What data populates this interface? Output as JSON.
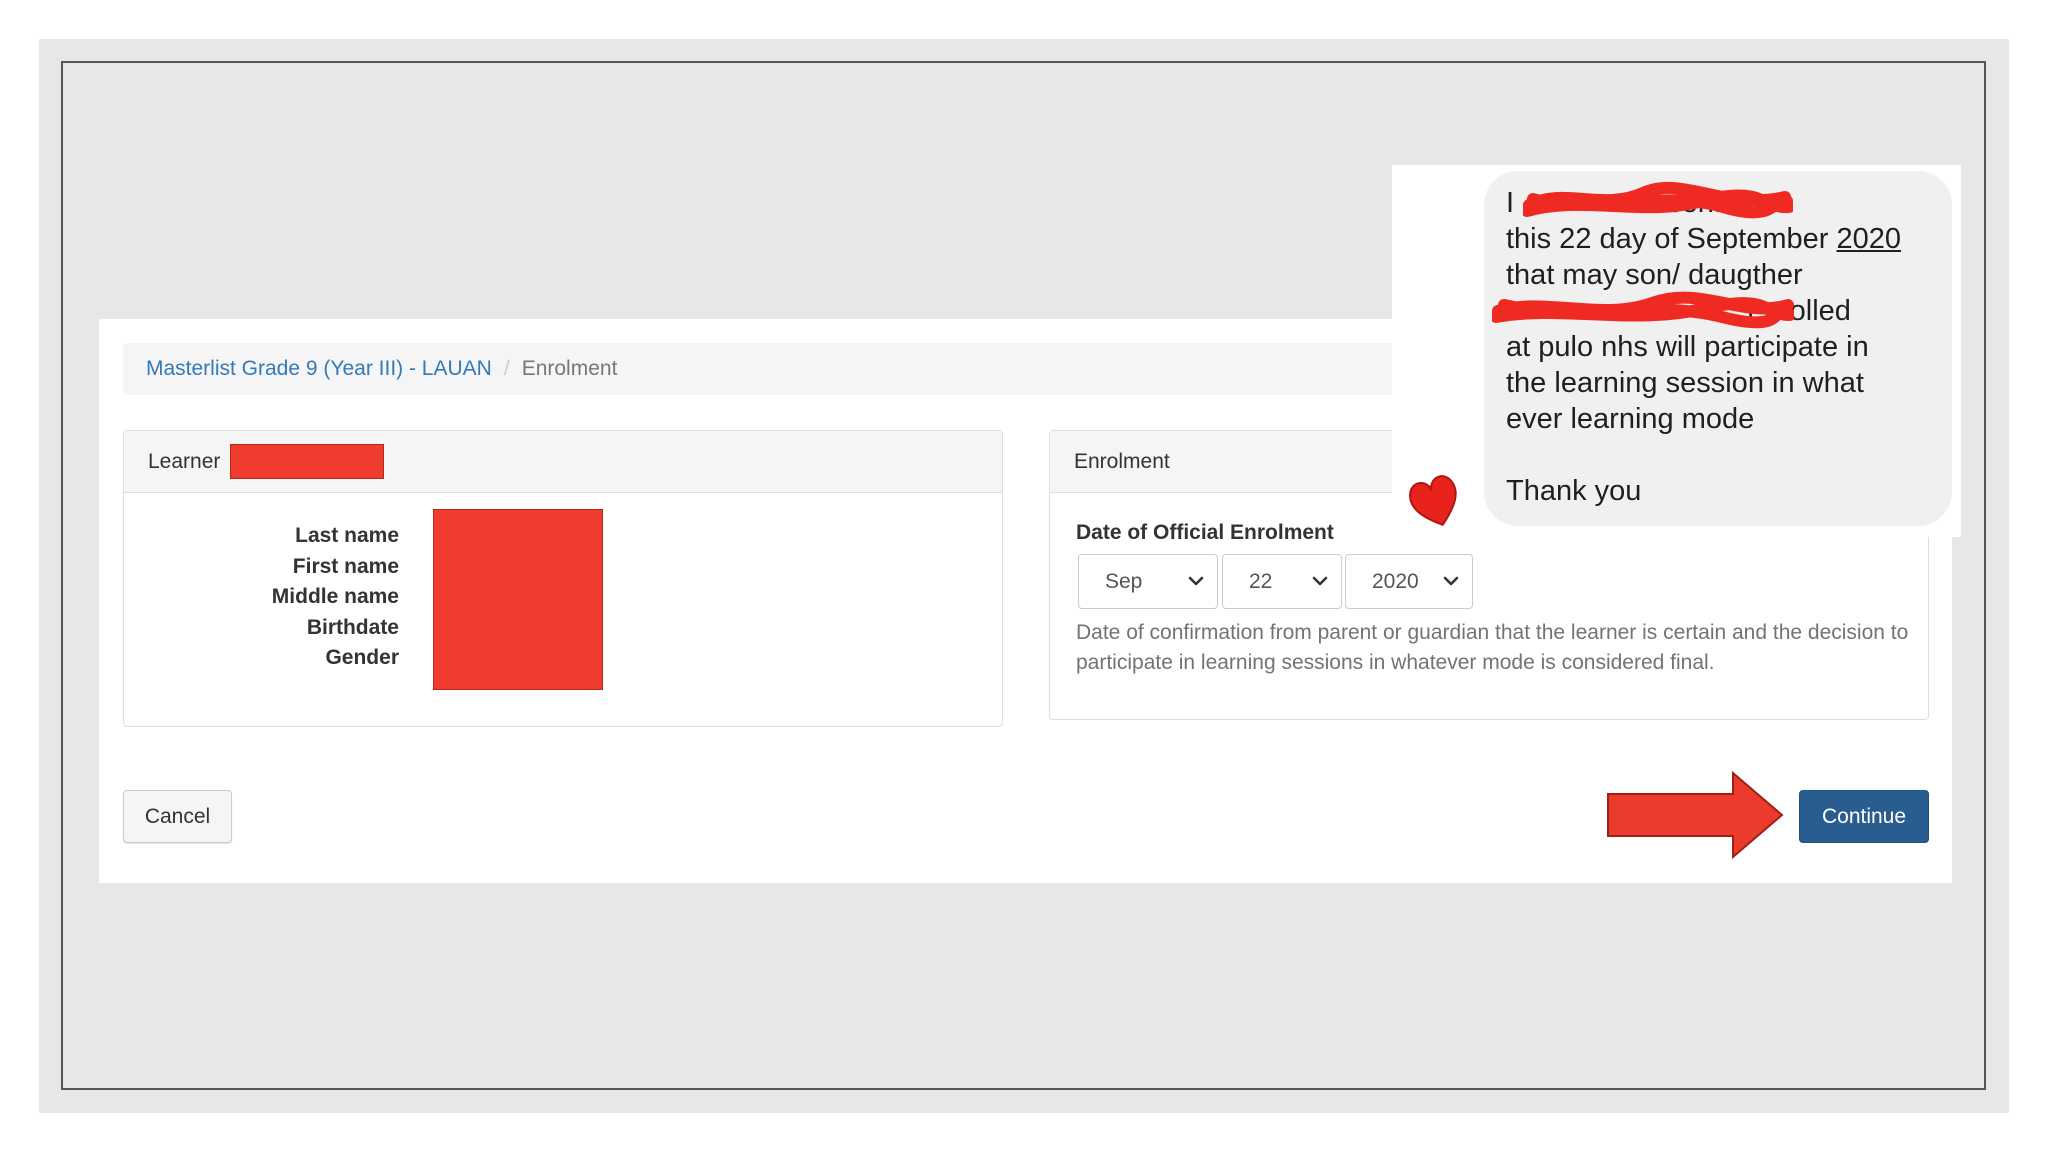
{
  "breadcrumb": {
    "link": "Masterlist Grade 9 (Year III) - LAUAN",
    "current": "Enrolment"
  },
  "learner": {
    "header": "Learner",
    "fields": [
      "Last name",
      "First name",
      "Middle name",
      "Birthdate",
      "Gender"
    ]
  },
  "enrolment": {
    "header": "Enrolment",
    "date_label": "Date of Official Enrolment",
    "month": "Sep",
    "day": "22",
    "year": "2020",
    "help_text": "Date of confirmation from parent or guardian that the learner is certain and the decision to participate in learning sessions in whatever mode is considered final."
  },
  "buttons": {
    "cancel": "Cancel",
    "continue": "Continue"
  },
  "chat": {
    "line1_start": "I",
    "line1_end": "confirms",
    "line2_start": "this 22 day of September ",
    "line2_year": "2020",
    "line3": "that may son/ daugther",
    "line4_end": "enrolled",
    "line5": "at pulo nhs will participate in",
    "line6": "the learning session in what",
    "line7": "ever learning mode",
    "line8": "Thank you"
  },
  "colors": {
    "redaction": "#f03c2e",
    "primary_button": "#2a5d8f",
    "link": "#337ab7",
    "annotation_arrow": "#ec3a2c"
  }
}
